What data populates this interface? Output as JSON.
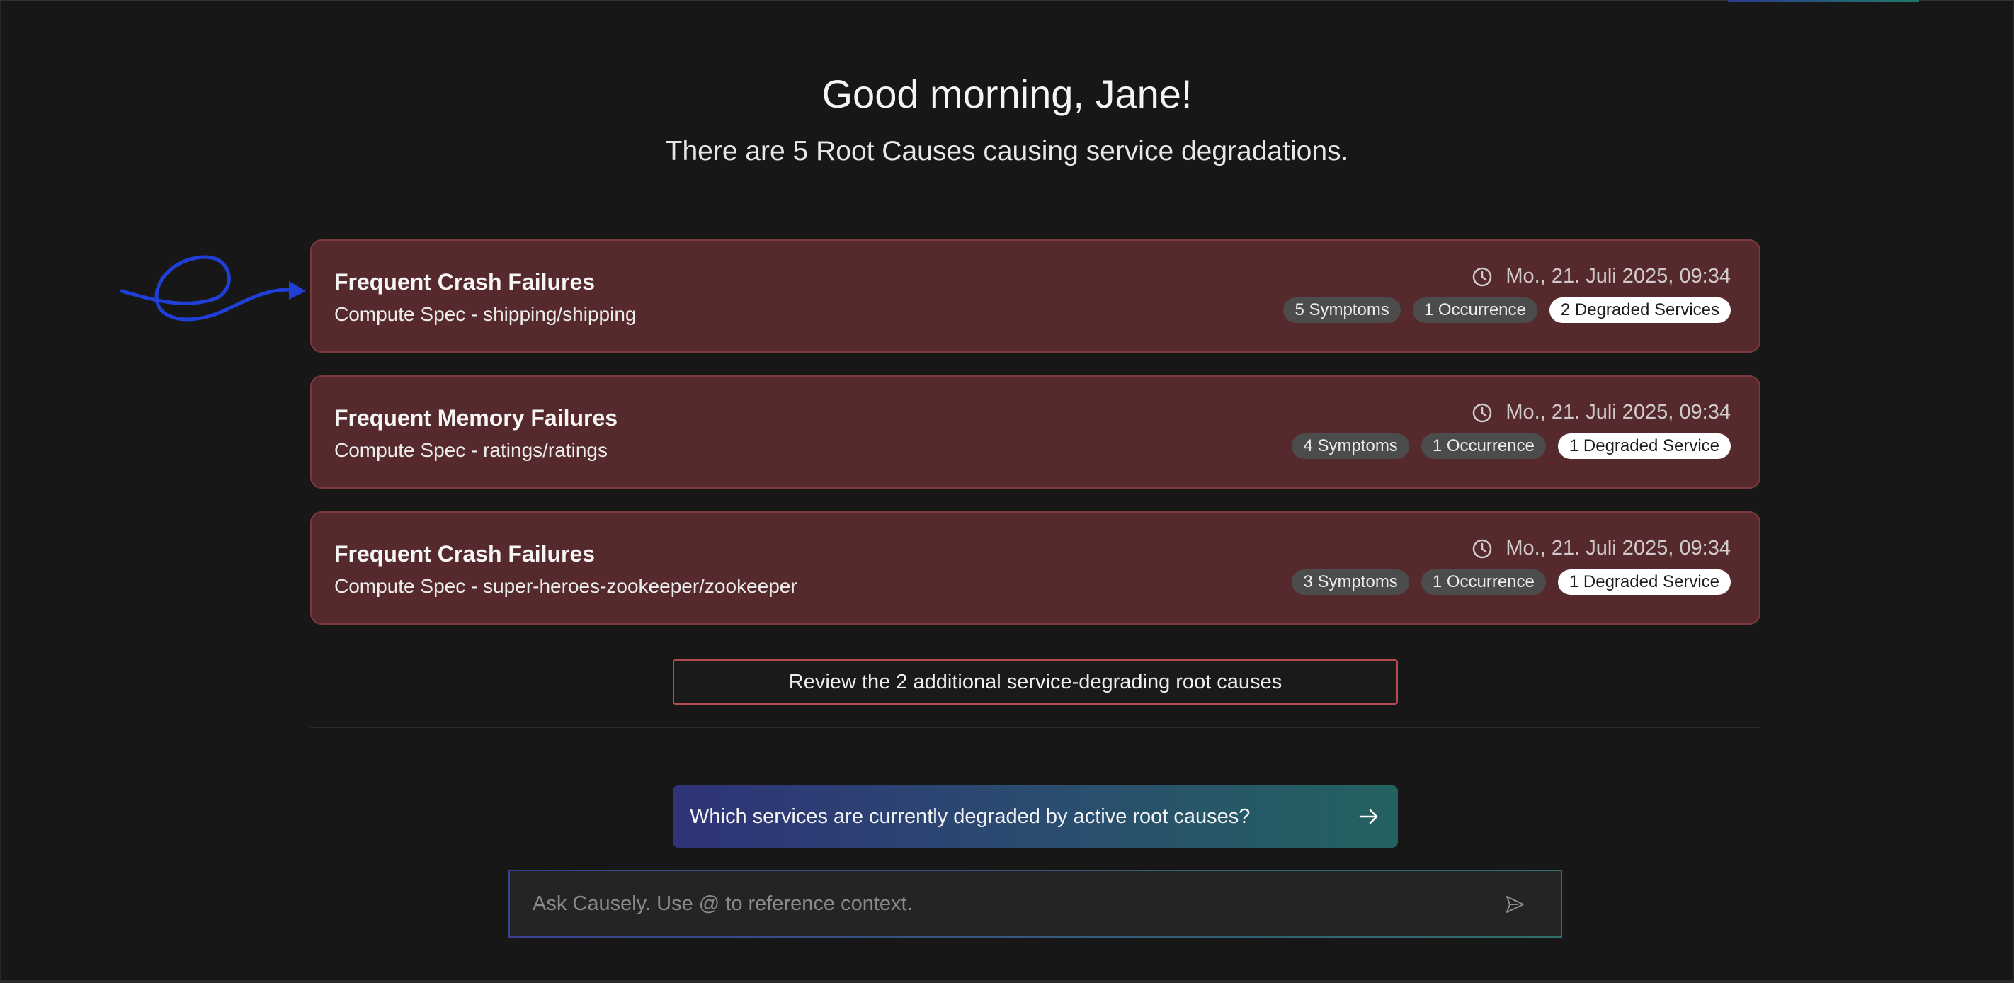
{
  "page": {
    "greeting": "Good morning, Jane!",
    "subtitle": "There are 5 Root Causes causing service degradations."
  },
  "root_causes": [
    {
      "title": "Frequent Crash Failures",
      "spec": "Compute Spec - shipping/shipping",
      "time": "Mo., 21. Juli 2025, 09:34",
      "symptoms": "5 Symptoms",
      "occurrences": "1 Occurrence",
      "degraded": "2 Degraded Services"
    },
    {
      "title": "Frequent Memory Failures",
      "spec": "Compute Spec - ratings/ratings",
      "time": "Mo., 21. Juli 2025, 09:34",
      "symptoms": "4 Symptoms",
      "occurrences": "1 Occurrence",
      "degraded": "1 Degraded Service"
    },
    {
      "title": "Frequent Crash Failures",
      "spec": "Compute Spec - super-heroes-zookeeper/zookeeper",
      "time": "Mo., 21. Juli 2025, 09:34",
      "symptoms": "3 Symptoms",
      "occurrences": "1 Occurrence",
      "degraded": "1 Degraded Service"
    }
  ],
  "review_button": "Review the 2 additional service-degrading root causes",
  "suggestion": "Which services are currently degraded by active root causes?",
  "ask": {
    "placeholder": "Ask Causely. Use @ to reference context."
  },
  "colors": {
    "background": "#171717",
    "card": "#562a2d",
    "card_border": "#7a3a3d",
    "annotation": "#1f3fd6"
  },
  "icons": [
    "clock-icon",
    "arrow-right-icon",
    "send-icon",
    "annotation-arrow"
  ]
}
